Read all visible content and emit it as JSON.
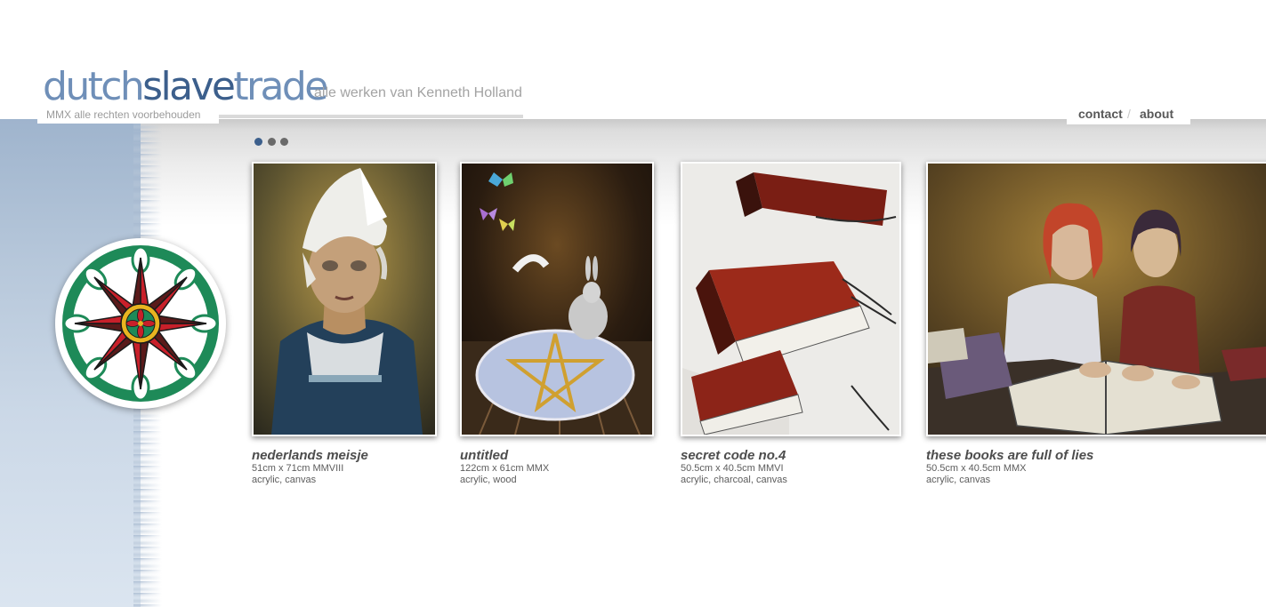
{
  "header": {
    "logo": {
      "part1": "dutch",
      "part2": "slave",
      "part3": "trade"
    },
    "tagline": "alle werken van Kenneth Holland",
    "copyright": "MMX alle rechten voorbehouden"
  },
  "nav": {
    "contact": "contact",
    "separator": "/",
    "about": "about"
  },
  "pager": {
    "pages": 3,
    "active": 1
  },
  "colors": {
    "logo_light": "#6f8fb8",
    "logo_dark": "#3c5f8c",
    "active_dot": "#3c5f8c",
    "inactive_dot": "#6a6a6a"
  },
  "artworks": [
    {
      "title": "nederlands meisje",
      "dimensions": "51cm x 71cm MMVIII",
      "materials": "acrylic, canvas"
    },
    {
      "title": "untitled",
      "dimensions": "122cm x 61cm MMX",
      "materials": "acrylic, wood"
    },
    {
      "title": "secret code no.4",
      "dimensions": "50.5cm x 40.5cm MMVI",
      "materials": "acrylic, charcoal, canvas"
    },
    {
      "title": "these books are full of lies",
      "dimensions": "50.5cm x 40.5cm MMX",
      "materials": "acrylic, canvas"
    }
  ]
}
